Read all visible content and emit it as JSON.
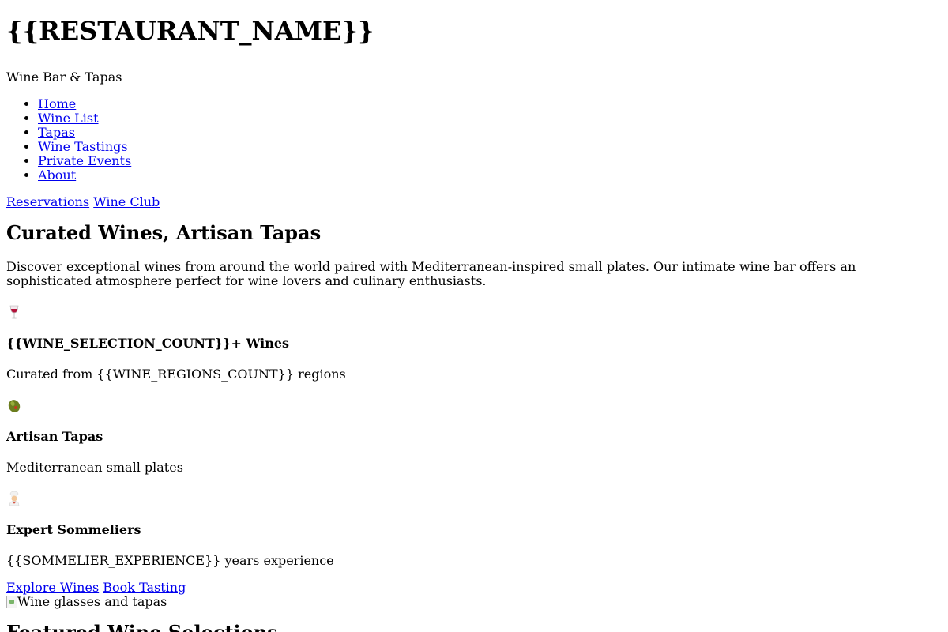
{
  "header": {
    "title": "{{RESTAURANT_NAME}}",
    "tagline": "Wine Bar & Tapas"
  },
  "nav": {
    "items": [
      {
        "label": "Home"
      },
      {
        "label": "Wine List"
      },
      {
        "label": "Tapas"
      },
      {
        "label": "Wine Tastings"
      },
      {
        "label": "Private Events"
      },
      {
        "label": "About"
      }
    ]
  },
  "header_actions": {
    "reservations": "Reservations",
    "wine_club": "Wine Club"
  },
  "hero": {
    "title": "Curated Wines, Artisan Tapas",
    "description": "Discover exceptional wines from around the world paired with Mediterranean-inspired small plates. Our intimate wine bar offers an sophisticated atmosphere perfect for wine lovers and culinary enthusiasts.",
    "features": [
      {
        "icon": "wine-glass-icon",
        "title": "{{WINE_SELECTION_COUNT}}+ Wines",
        "text": "Curated from {{WINE_REGIONS_COUNT}} regions"
      },
      {
        "icon": "olive-icon",
        "title": "Artisan Tapas",
        "text": "Mediterranean small plates"
      },
      {
        "icon": "chef-icon",
        "title": "Expert Sommeliers",
        "text": "{{SOMMELIER_EXPERIENCE}} years experience"
      }
    ],
    "cta": {
      "explore": "Explore Wines",
      "book": "Book Tasting"
    },
    "image_alt": "Wine glasses and tapas"
  },
  "featured": {
    "title": "Featured Wine Selections"
  }
}
